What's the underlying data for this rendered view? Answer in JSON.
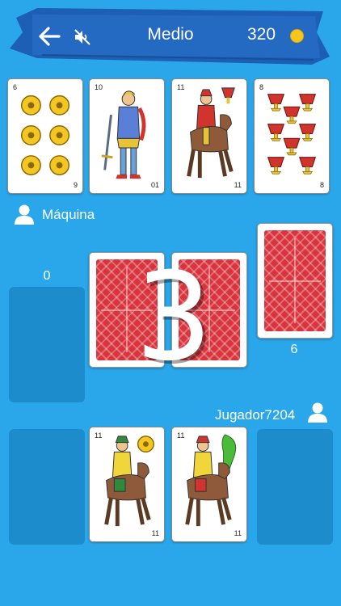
{
  "header": {
    "title": "Medio",
    "coins": "320",
    "back_icon": "arrow-left-icon",
    "mute_icon": "sound-off-icon",
    "coin_icon": "gold-coin-icon",
    "ribbon_color": "#1d5fb5"
  },
  "table": {
    "background_color": "#2aa7ea",
    "slot_color": "#1d8ccc",
    "card_back_color": "#d8343d"
  },
  "top_cards": [
    {
      "suit": "oros",
      "rank": "6",
      "rank_bottom": "9",
      "icon": "gold-coins-card"
    },
    {
      "suit": "espadas",
      "rank": "10",
      "rank_bottom": "01",
      "icon": "sword-page-card"
    },
    {
      "suit": "copas",
      "rank": "11",
      "rank_bottom": "11",
      "icon": "cups-knight-card"
    },
    {
      "suit": "copas",
      "rank": "8",
      "rank_bottom": "8",
      "icon": "eight-cups-card"
    }
  ],
  "opponent": {
    "name": "Máquina",
    "score": "0"
  },
  "deck": {
    "remaining": "6"
  },
  "countdown": "3",
  "player": {
    "name": "Jugador7204"
  },
  "hand_cards": [
    {
      "suit": "oros",
      "rank": "11",
      "rank_bottom": "11",
      "icon": "coins-knight-card"
    },
    {
      "suit": "bastos",
      "rank": "11",
      "rank_bottom": "11",
      "icon": "clubs-knight-card"
    }
  ]
}
